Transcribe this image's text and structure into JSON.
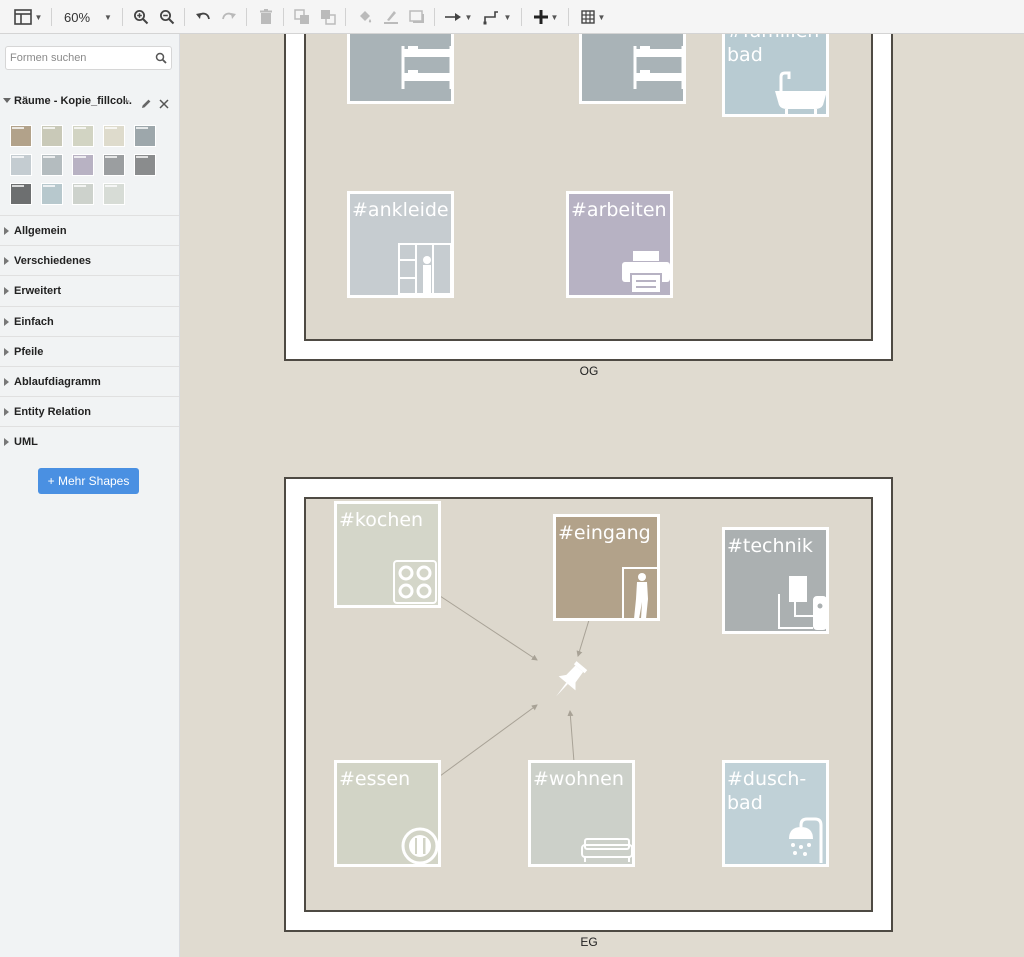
{
  "toolbar": {
    "zoom": "60%",
    "icons": [
      "layout-icon",
      "zoom-in-icon",
      "zoom-out-icon",
      "undo-icon",
      "redo-icon",
      "delete-icon",
      "to-front-icon",
      "to-back-icon",
      "fill-color-icon",
      "line-color-icon",
      "shadow-icon",
      "connection-icon",
      "waypoints-icon",
      "insert-icon",
      "table-icon"
    ]
  },
  "sidebar": {
    "search_placeholder": "Formen suchen",
    "library_title": "Räume - Kopie_fillcol...",
    "thumb_colors": [
      "#b2a28a",
      "#c9c9b8",
      "#d2d4c3",
      "#dedbcc",
      "#9da7ab",
      "#c4ccd1",
      "#b4bcbf",
      "#b8b2c3",
      "#9b9ea0",
      "#8a8c8d",
      "#6d6f70",
      "#b7c8cd",
      "#cdd2cc",
      "#d7dcd6"
    ],
    "sections": [
      "Allgemein",
      "Verschiedenes",
      "Erweitert",
      "Einfach",
      "Pfeile",
      "Ablaufdiagramm",
      "Entity Relation",
      "UML"
    ],
    "more_shapes": "+ Mehr Shapes"
  },
  "diagram": {
    "og": {
      "label": "OG",
      "rooms": [
        {
          "id": "og-room-1",
          "text": "",
          "color": "#a9b3b7",
          "icon": "bunk-bed-icon"
        },
        {
          "id": "og-room-2",
          "text": "",
          "color": "#a9b3b7",
          "icon": "bunk-bed-icon"
        },
        {
          "id": "familienbad",
          "text": "#familien-\nbad",
          "color": "#b8cbd2",
          "icon": "bathtub-icon"
        },
        {
          "id": "ankleide",
          "text": "#ankleide",
          "color": "#c6ccd0",
          "icon": "wardrobe-icon"
        },
        {
          "id": "arbeiten",
          "text": "#arbeiten",
          "color": "#b7b2c3",
          "icon": "printer-icon"
        }
      ]
    },
    "eg": {
      "label": "EG",
      "rooms": [
        {
          "id": "kochen",
          "text": "#kochen",
          "color": "#d4d6c9",
          "icon": "stove-icon"
        },
        {
          "id": "eingang",
          "text": "#eingang",
          "color": "#b2a28a",
          "icon": "entrance-door-icon"
        },
        {
          "id": "technik",
          "text": "#technik",
          "color": "#abb0b1",
          "icon": "boiler-icon"
        },
        {
          "id": "essen",
          "text": "#essen",
          "color": "#d2d4c6",
          "icon": "plate-cutlery-icon"
        },
        {
          "id": "wohnen",
          "text": "#wohnen",
          "color": "#ccd0c9",
          "icon": "sofa-icon"
        },
        {
          "id": "duschbad",
          "text": "#dusch-\nbad",
          "color": "#c0d1d7",
          "icon": "shower-icon"
        }
      ],
      "center_icon": "pushpin-icon"
    }
  }
}
